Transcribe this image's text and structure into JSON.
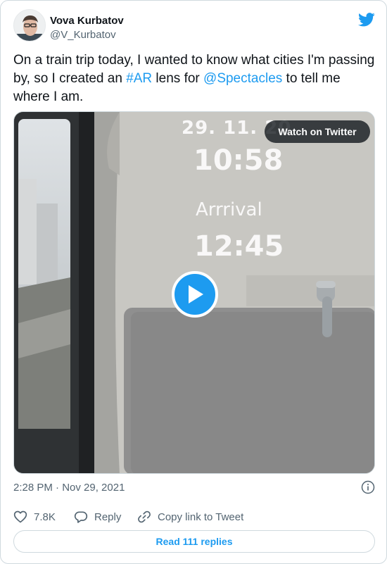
{
  "author": {
    "name": "Vova Kurbatov",
    "handle": "@V_Kurbatov"
  },
  "tweet": {
    "text_before_hashtag": "On a train trip today, I wanted to know what cities I'm passing by, so I created an ",
    "hashtag": "#AR",
    "text_middle": " lens for ",
    "mention": "@Spectacles",
    "text_after": " to tell me where I am."
  },
  "media": {
    "watch_label": "Watch on Twitter",
    "overlay": {
      "date": "29. 11. 20",
      "time": "10:58",
      "arrival_label": "Arrrival",
      "arrival_time": "12:45"
    }
  },
  "timestamp": "2:28 PM · Nov 29, 2021",
  "actions": {
    "likes": "7.8K",
    "reply_label": "Reply",
    "copy_link_label": "Copy link to Tweet"
  },
  "read_replies_label": "Read 111 replies",
  "colors": {
    "accent": "#1d9bf0",
    "text": "#0f1419",
    "muted": "#536471",
    "border": "#cfd9de"
  },
  "icons": [
    "twitter-bird-icon",
    "play-icon",
    "info-icon",
    "heart-icon",
    "reply-icon",
    "link-icon"
  ]
}
